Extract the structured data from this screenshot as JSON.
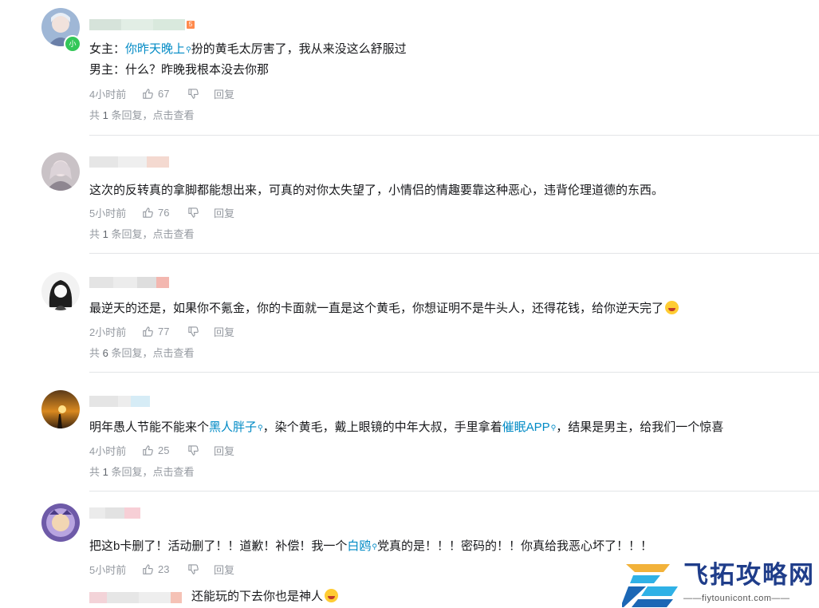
{
  "comments": [
    {
      "text_before": "女主：",
      "link1": "你昨天晚上",
      "text_after": "扮的黄毛太厉害了，我从来没这么舒服过",
      "line2": "男主：什么？昨晚我根本没去你那",
      "time": "4小时前",
      "likes": "67",
      "reply_label": "回复",
      "sub_prefix": "共",
      "sub_count": "1",
      "sub_mid": "条回复，",
      "sub_click": "点击查看"
    },
    {
      "text": "这次的反转真的拿脚都能想出来，可真的对你太失望了，小情侣的情趣要靠这种恶心，违背伦理道德的东西。",
      "time": "5小时前",
      "likes": "76",
      "reply_label": "回复",
      "sub_prefix": "共",
      "sub_count": "1",
      "sub_mid": "条回复，",
      "sub_click": "点击查看"
    },
    {
      "text": "最逆天的还是，如果你不氪金，你的卡面就一直是这个黄毛，你想证明不是牛头人，还得花钱，给你逆天完了",
      "time": "2小时前",
      "likes": "77",
      "reply_label": "回复",
      "sub_prefix": "共",
      "sub_count": "6",
      "sub_mid": "条回复，",
      "sub_click": "点击查看"
    },
    {
      "text_before": "明年愚人节能不能来个",
      "link1": "黑人胖子",
      "text_mid": "，染个黄毛，戴上眼镜的中年大叔，手里拿着",
      "link2": "催眠APP",
      "text_after": "，结果是男主，给我们一个惊喜",
      "time": "4小时前",
      "likes": "25",
      "reply_label": "回复",
      "sub_prefix": "共",
      "sub_count": "1",
      "sub_mid": "条回复，",
      "sub_click": "点击查看"
    },
    {
      "text_before": "把这b卡删了！活动删了！！道歉！补偿！我一个",
      "link1": "白鸥",
      "text_after": "党真的是！！！密码的！！你真给我恶心坏了！！！",
      "time": "5小时前",
      "likes": "23",
      "reply_label": "回复"
    }
  ],
  "partial_reply": {
    "text": "还能玩的下去你也是神人"
  },
  "first_user_badge": "小",
  "level_badge": "5",
  "watermark": {
    "title": "飞拓攻略网",
    "url": "——fiytounicont.com——"
  },
  "colors": {
    "link": "#008ac5",
    "meta": "#9499a0",
    "divider": "#e3e5e7"
  }
}
